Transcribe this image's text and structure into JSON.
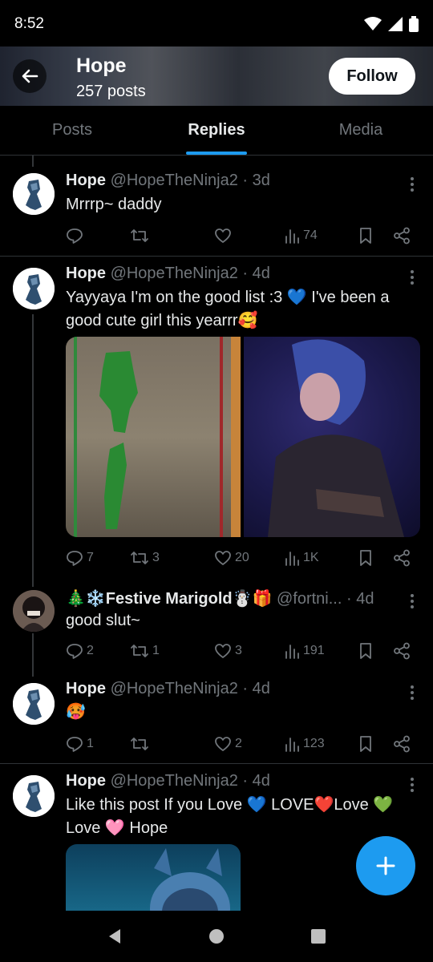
{
  "status": {
    "time": "8:52"
  },
  "header": {
    "title": "Hope",
    "post_count": "257 posts",
    "follow_label": "Follow"
  },
  "tabs": [
    {
      "label": "Posts"
    },
    {
      "label": "Replies",
      "active": true
    },
    {
      "label": "Media"
    }
  ],
  "posts": [
    {
      "name": "Hope",
      "handle": "@HopeTheNinja2",
      "time": "· 3d",
      "text": "Mrrrp~ daddy",
      "replies": "",
      "reposts": "",
      "likes": "",
      "views": "74"
    },
    {
      "name": "Hope",
      "handle": "@HopeTheNinja2",
      "time": "· 4d",
      "text": "Yayyaya I'm on the good list :3 💙 I've been a good cute girl this yearrr🥰",
      "replies": "7",
      "reposts": "3",
      "likes": "20",
      "views": "1K"
    },
    {
      "name": "🎄❄️Festive Marigold☃️🎁",
      "handle": "@fortni...",
      "time": "· 4d",
      "text": "good slut~",
      "replies": "2",
      "reposts": "1",
      "likes": "3",
      "views": "191"
    },
    {
      "name": "Hope",
      "handle": "@HopeTheNinja2",
      "time": "· 4d",
      "text": "🥵",
      "replies": "1",
      "reposts": "",
      "likes": "2",
      "views": "123"
    },
    {
      "name": "Hope",
      "handle": "@HopeTheNinja2",
      "time": "· 4d",
      "text": "Like this post If you Love 💙 LOVE❤️Love 💚 Love 🩷 Hope"
    }
  ]
}
